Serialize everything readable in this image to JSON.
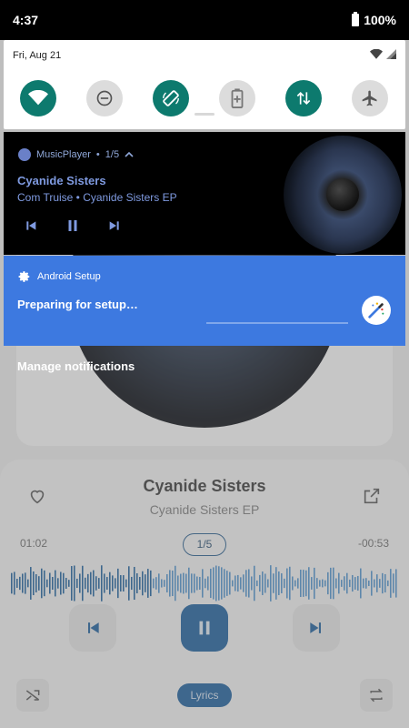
{
  "status_bar": {
    "time": "4:37",
    "battery": "100%"
  },
  "quick_settings": {
    "date": "Fri, Aug 21",
    "tiles": [
      {
        "name": "wifi",
        "icon": "wifi-icon",
        "state": "on"
      },
      {
        "name": "dnd",
        "icon": "do-not-disturb-icon",
        "state": "off"
      },
      {
        "name": "auto-rotate",
        "icon": "rotate-icon",
        "state": "on"
      },
      {
        "name": "battery-saver",
        "icon": "battery-saver-icon",
        "state": "off"
      },
      {
        "name": "mobile-data",
        "icon": "data-arrows-icon",
        "state": "on"
      },
      {
        "name": "airplane",
        "icon": "airplane-icon",
        "state": "off"
      }
    ]
  },
  "media_notification": {
    "app_name": "MusicPlayer",
    "counter": "1/5",
    "title": "Cyanide Sisters",
    "subtitle": "Com Truise • Cyanide Sisters EP"
  },
  "setup_notification": {
    "app_name": "Android Setup",
    "text": "Preparing for setup…"
  },
  "manage_notifications_label": "Manage notifications",
  "background_player": {
    "title": "Cyanide Sisters",
    "album": "Cyanide Sisters EP",
    "elapsed": "01:02",
    "remaining": "-00:53",
    "counter": "1/5",
    "lyrics_label": "Lyrics"
  },
  "colors": {
    "accent_teal": "#0d7a6e",
    "setup_blue": "#3d79e0",
    "media_text": "#7f9ae0",
    "player_blue": "#1f5e99"
  }
}
